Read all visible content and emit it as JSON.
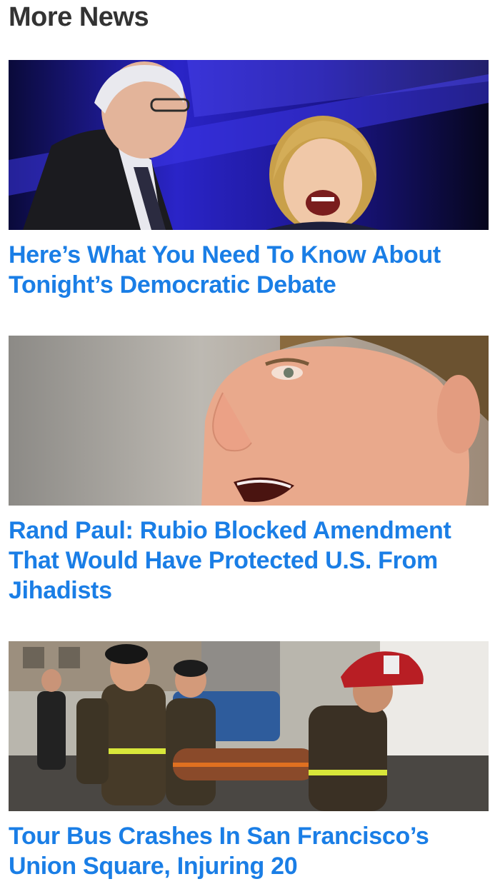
{
  "section": {
    "title": "More News"
  },
  "articles": [
    {
      "headline": "Here’s What You Need To Know About Tonight’s Democratic Debate",
      "image_alt": "Two candidates smiling at a debate stage"
    },
    {
      "headline": "Rand Paul: Rubio Blocked Amendment That Would Have Protected U.S. From Jihadists",
      "image_alt": "Close-up of a man speaking"
    },
    {
      "headline": "Tour Bus Crashes In San Francisco’s Union Square, Injuring 20",
      "image_alt": "Firefighters carrying an injured person on a stretcher"
    }
  ],
  "colors": {
    "title": "#333333",
    "headline_link": "#1a7ee6",
    "background": "#ffffff"
  }
}
